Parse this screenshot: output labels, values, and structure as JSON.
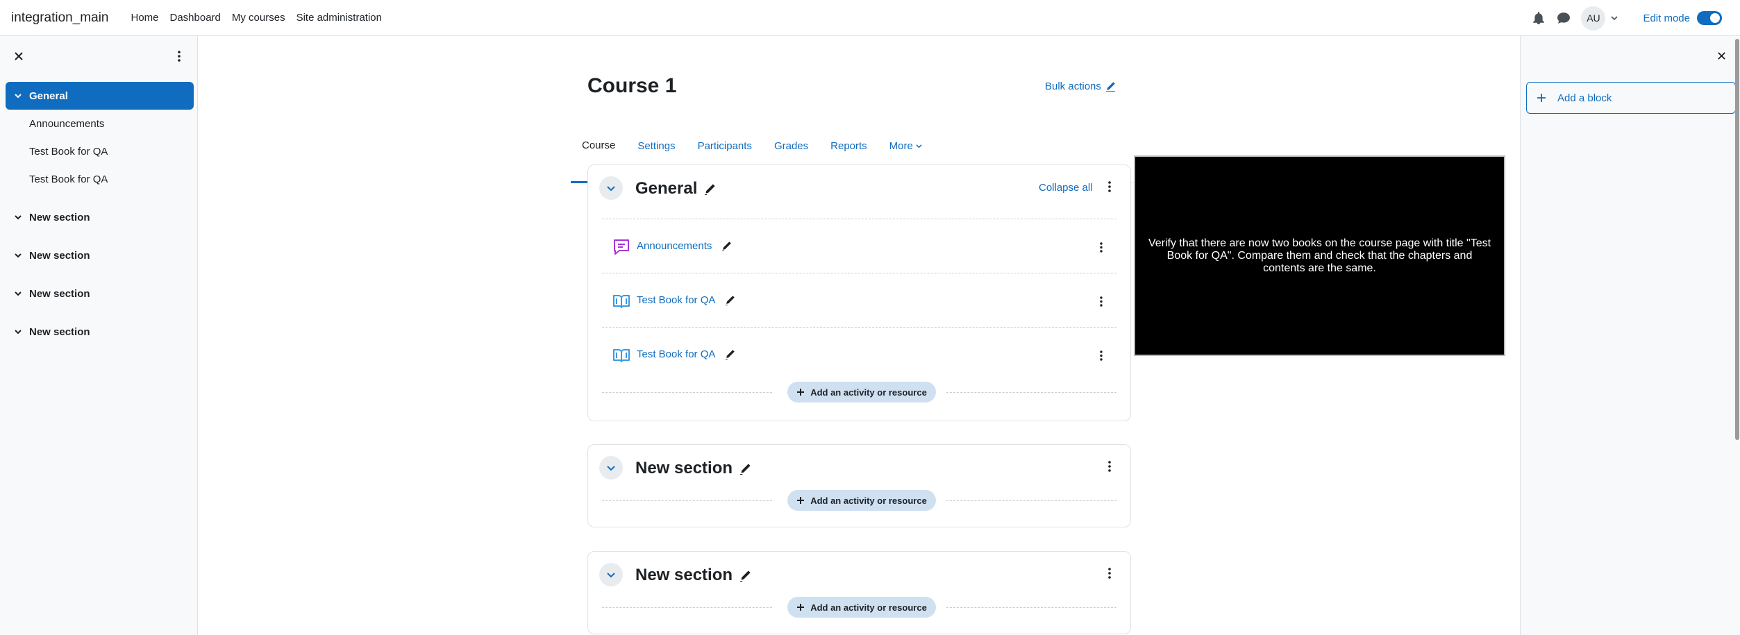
{
  "navbar": {
    "brand": "integration_main",
    "links": [
      "Home",
      "Dashboard",
      "My courses",
      "Site administration"
    ],
    "avatar_initials": "AU",
    "edit_mode_label": "Edit mode",
    "edit_mode_on": true
  },
  "course_index": {
    "sections": [
      {
        "title": "General",
        "active": true,
        "items": [
          "Announcements",
          "Test Book for QA",
          "Test Book for QA"
        ]
      },
      {
        "title": "New section"
      },
      {
        "title": "New section"
      },
      {
        "title": "New section"
      },
      {
        "title": "New section"
      }
    ]
  },
  "course": {
    "title": "Course 1",
    "bulk_actions": "Bulk actions",
    "tabs": [
      "Course",
      "Settings",
      "Participants",
      "Grades",
      "Reports",
      "More"
    ],
    "active_tab": "Course",
    "collapse_all": "Collapse all",
    "add_activity_label": "Add an activity or resource",
    "sections": [
      {
        "title": "General",
        "activities": [
          {
            "name": "Announcements",
            "icon": "forum-icon"
          },
          {
            "name": "Test Book for QA",
            "icon": "book-icon"
          },
          {
            "name": "Test Book for QA",
            "icon": "book-icon"
          }
        ]
      },
      {
        "title": "New section",
        "activities": []
      },
      {
        "title": "New section",
        "activities": []
      }
    ]
  },
  "overlay_text": "Verify that there are now two books on the course page with title \"Test Book for QA\". Compare them and check that the chapters and contents are the same.",
  "block_drawer": {
    "add_block": "Add a block"
  },
  "colors": {
    "primary": "#0f6cbf",
    "forum_icon": "#a933d7",
    "book_icon": "#399be2"
  }
}
